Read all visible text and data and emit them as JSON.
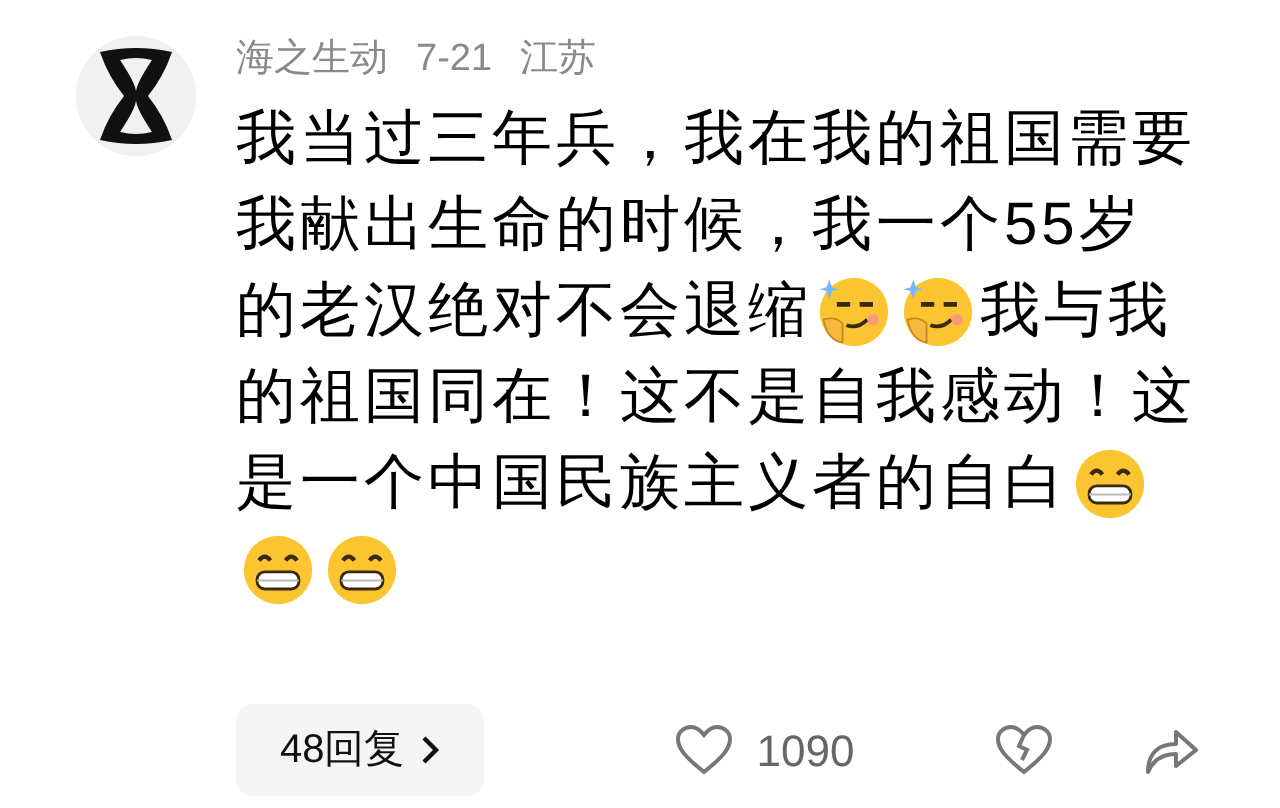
{
  "comment": {
    "username": "海之生动",
    "date": "7-21",
    "location": "江苏",
    "lines": [
      [
        {
          "kind": "text",
          "text": "我当过三年兵，我在我的祖国需要"
        }
      ],
      [
        {
          "kind": "text",
          "text": "我献出生命的时候，我一个55岁"
        }
      ],
      [
        {
          "kind": "text",
          "text": "的老汉绝对不会退缩"
        },
        {
          "kind": "smug"
        },
        {
          "kind": "smug"
        },
        {
          "kind": "text",
          "text": "我与我"
        }
      ],
      [
        {
          "kind": "text",
          "text": "的祖国同在！这不是自我感动！这"
        }
      ],
      [
        {
          "kind": "text",
          "text": "是一个中国民族主义者的自白"
        },
        {
          "kind": "grin"
        }
      ],
      [
        {
          "kind": "grin"
        },
        {
          "kind": "grin"
        }
      ]
    ],
    "replies_button": "48回复",
    "likes": "1090"
  }
}
